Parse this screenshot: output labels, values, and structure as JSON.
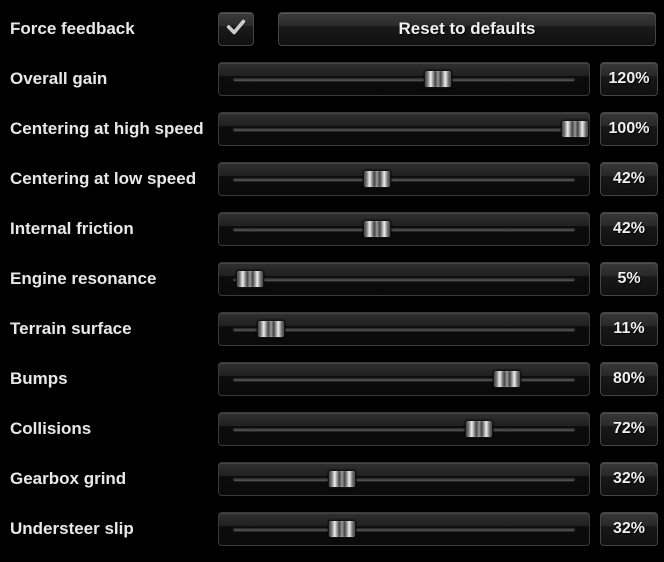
{
  "header": {
    "title": "Force feedback",
    "checked": true,
    "reset_label": "Reset to defaults"
  },
  "sliders": [
    {
      "label": "Overall gain",
      "value": 120,
      "display": "120%",
      "min": 0,
      "max": 200
    },
    {
      "label": "Centering at high speed",
      "value": 100,
      "display": "100%",
      "min": 0,
      "max": 100
    },
    {
      "label": "Centering at low speed",
      "value": 42,
      "display": "42%",
      "min": 0,
      "max": 100
    },
    {
      "label": "Internal friction",
      "value": 42,
      "display": "42%",
      "min": 0,
      "max": 100
    },
    {
      "label": "Engine resonance",
      "value": 5,
      "display": "5%",
      "min": 0,
      "max": 100
    },
    {
      "label": "Terrain surface",
      "value": 11,
      "display": "11%",
      "min": 0,
      "max": 100
    },
    {
      "label": "Bumps",
      "value": 80,
      "display": "80%",
      "min": 0,
      "max": 100
    },
    {
      "label": "Collisions",
      "value": 72,
      "display": "72%",
      "min": 0,
      "max": 100
    },
    {
      "label": "Gearbox grind",
      "value": 32,
      "display": "32%",
      "min": 0,
      "max": 100
    },
    {
      "label": "Understeer slip",
      "value": 32,
      "display": "32%",
      "min": 0,
      "max": 100
    }
  ]
}
